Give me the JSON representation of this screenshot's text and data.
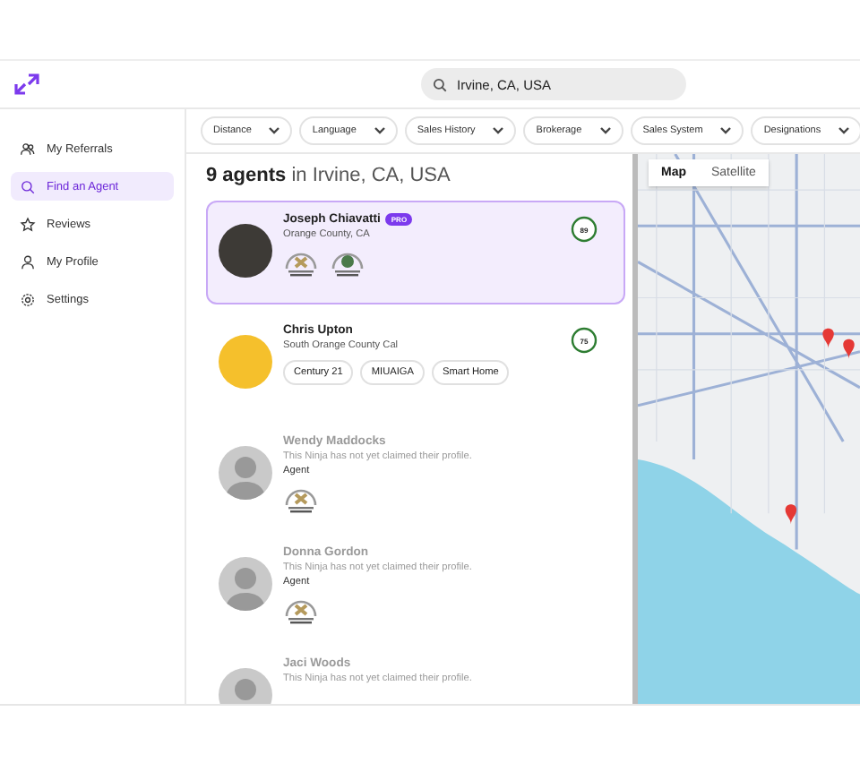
{
  "search": {
    "value": "Irvine, CA, USA"
  },
  "sidebar": {
    "items": [
      {
        "label": "My Referrals",
        "selected": false
      },
      {
        "label": "Find an Agent",
        "selected": true
      },
      {
        "label": "Reviews",
        "selected": false
      },
      {
        "label": "My Profile",
        "selected": false
      },
      {
        "label": "Settings",
        "selected": false
      }
    ]
  },
  "filters": [
    "Distance",
    "Language",
    "Sales History",
    "Brokerage",
    "Sales System",
    "Designations"
  ],
  "results": {
    "count": "9 agents",
    "location": "in Irvine, CA, USA"
  },
  "agents": [
    {
      "kind": "photo",
      "name": "Joseph Chiavatti",
      "tier": "PRO",
      "selected": true,
      "area": "Orange County, CA",
      "score": "89",
      "badges": [
        {
          "kind": "butterfly"
        },
        {
          "kind": "tree"
        }
      ]
    },
    {
      "kind": "photo",
      "name": "Chris Upton",
      "selected": false,
      "area": "South Orange County Cal",
      "score": "75",
      "tags": [
        "Century 21",
        "MIUAIGA",
        "Smart Home"
      ]
    },
    {
      "kind": "unclaimed",
      "name": "Wendy Maddocks",
      "note": "This Ninja has not yet claimed their profile.",
      "role": "Agent",
      "badges": [
        {
          "kind": "butterfly"
        }
      ]
    },
    {
      "kind": "unclaimed",
      "name": "Donna Gordon",
      "note": "This Ninja has not yet claimed their profile.",
      "role": "Agent",
      "badges": [
        {
          "kind": "butterfly"
        }
      ]
    },
    {
      "kind": "unclaimed",
      "name": "Jaci Woods",
      "note": "This Ninja has not yet claimed their profile."
    }
  ],
  "map": {
    "modes": [
      {
        "label": "Map",
        "selected": true
      },
      {
        "label": "Satellite",
        "selected": false
      }
    ]
  }
}
